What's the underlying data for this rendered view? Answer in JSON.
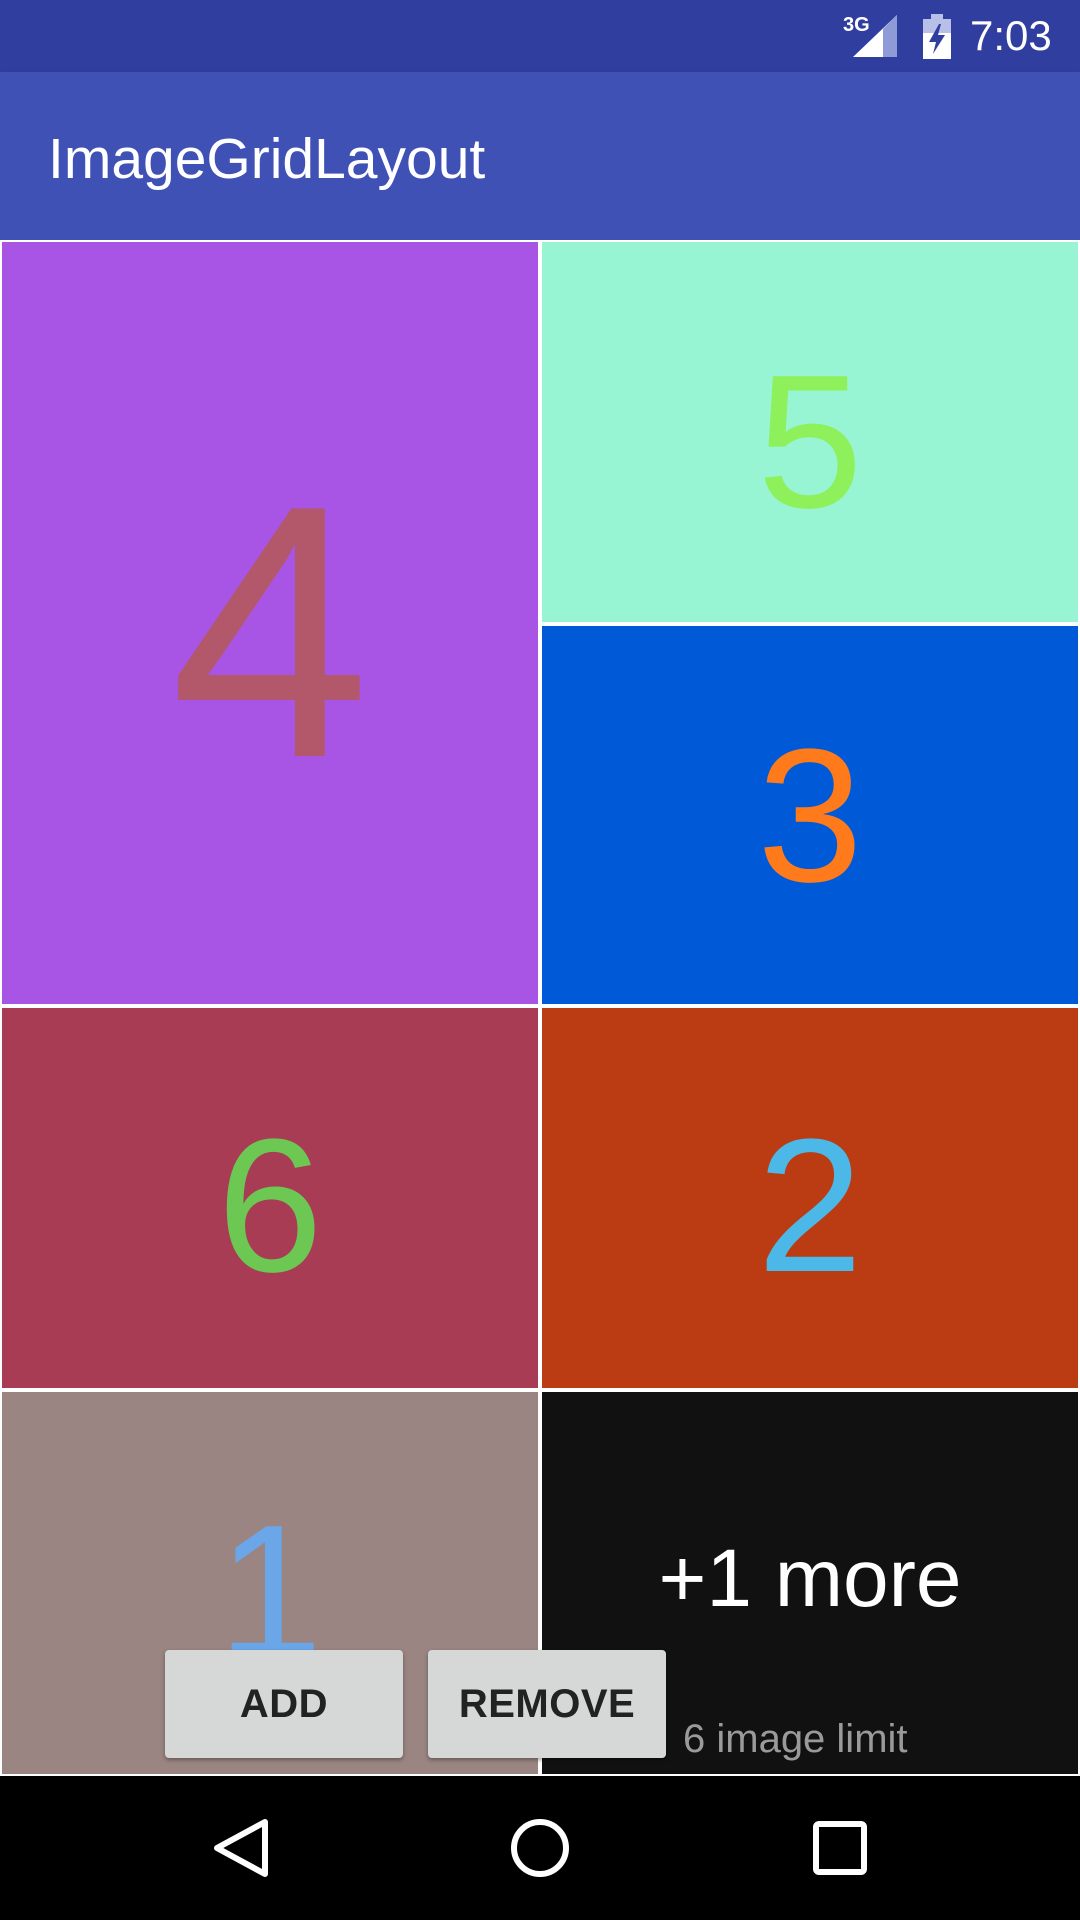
{
  "status_bar": {
    "network": "3G",
    "time": "7:03",
    "icons": [
      "signal-icon",
      "battery-charging-icon"
    ]
  },
  "app_bar": {
    "title": "ImageGridLayout"
  },
  "grid": {
    "tiles": [
      {
        "label": "4",
        "background": "#a855e6",
        "text_color": "#b2586a"
      },
      {
        "label": "5",
        "background": "#97f5d3",
        "text_color": "#8ef05a"
      },
      {
        "label": "3",
        "background": "#005ad7",
        "text_color": "#ff7a1a"
      },
      {
        "label": "6",
        "background": "#a83c54",
        "text_color": "#6cc853"
      },
      {
        "label": "2",
        "background": "#bb3b12",
        "text_color": "#4bb8e8"
      },
      {
        "label": "1",
        "background": "#9a8582",
        "text_color": "#6aa6e8"
      }
    ],
    "overflow_tile": {
      "label": "+1 more",
      "background": "#111111",
      "text_color": "#ffffff"
    }
  },
  "controls": {
    "add_label": "ADD",
    "remove_label": "REMOVE",
    "limit_text": "6 image limit"
  },
  "nav_bar": {
    "icons": [
      "back-icon",
      "home-icon",
      "recents-icon"
    ]
  },
  "colors": {
    "status_bar": "#303f9f",
    "app_bar": "#3f51b5",
    "nav_bar": "#000000",
    "button": "#d6d7d7"
  }
}
